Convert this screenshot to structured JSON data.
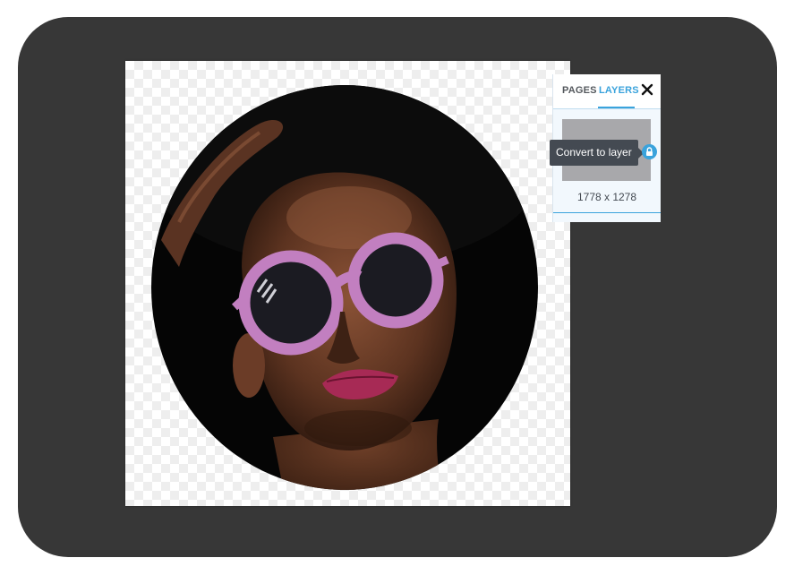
{
  "canvas": {
    "image_description_icon": "portrait-photo-circle"
  },
  "panel": {
    "tabs": [
      {
        "label": "PAGES"
      },
      {
        "label": "LAYERS"
      }
    ],
    "close_icon": "close-icon",
    "layer": {
      "tooltip": "Convert to layer",
      "lock_icon": "lock-icon",
      "dimensions": "1778 x 1278"
    }
  },
  "colors": {
    "window_bg": "#373737",
    "accent": "#3aa3dc",
    "panel_bg": "#f2f8fd",
    "tooltip_bg": "#444a52",
    "thumb_bg": "#a8a8ab"
  }
}
